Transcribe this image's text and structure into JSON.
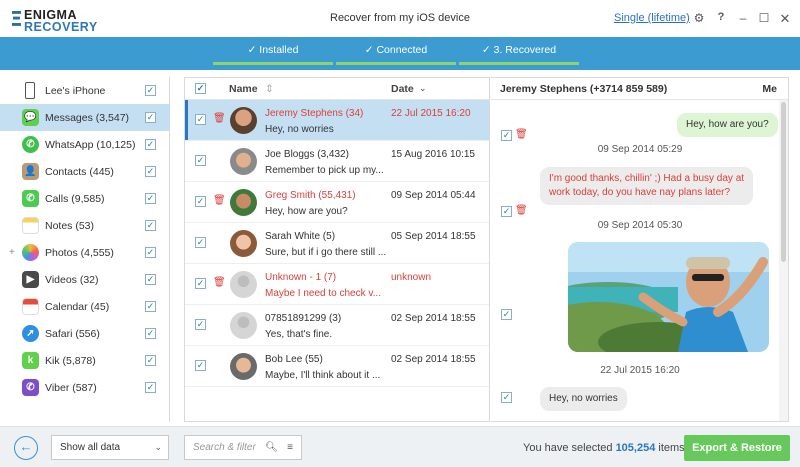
{
  "app": {
    "logo_line1": "ENIGMA",
    "logo_line2": "RECOVERY",
    "window_title": "Recover from my iOS device",
    "license_link": "Single (lifetime)",
    "icons": [
      "gear-icon",
      "help-icon",
      "minimize-icon",
      "maximize-icon",
      "close-icon"
    ]
  },
  "steps": [
    {
      "label": "Installed"
    },
    {
      "label": "Connected"
    },
    {
      "label": "3. Recovered"
    }
  ],
  "sidebar": {
    "items": [
      {
        "label": "Lee's iPhone",
        "icon": "iphone-icon",
        "checked": true
      },
      {
        "label": "Messages (3,547)",
        "icon": "messages-icon",
        "checked": true,
        "active": true
      },
      {
        "label": "WhatsApp (10,125)",
        "icon": "whatsapp-icon",
        "checked": true
      },
      {
        "label": "Contacts (445)",
        "icon": "contacts-icon",
        "checked": true
      },
      {
        "label": "Calls (9,585)",
        "icon": "calls-icon",
        "checked": true
      },
      {
        "label": "Notes (53)",
        "icon": "notes-icon",
        "checked": true
      },
      {
        "label": "Photos (4,555)",
        "icon": "photos-icon",
        "checked": true,
        "expandable": true
      },
      {
        "label": "Videos (32)",
        "icon": "videos-icon",
        "checked": true
      },
      {
        "label": "Calendar (45)",
        "icon": "calendar-icon",
        "checked": true
      },
      {
        "label": "Safari (556)",
        "icon": "safari-icon",
        "checked": true
      },
      {
        "label": "Kik (5,878)",
        "icon": "kik-icon",
        "checked": true
      },
      {
        "label": "Viber (587)",
        "icon": "viber-icon",
        "checked": true
      }
    ]
  },
  "list": {
    "headers": {
      "name": "Name",
      "date": "Date"
    },
    "rows": [
      {
        "name": "Jeremy Stephens (34)",
        "message": "Hey, no worries",
        "date": "22 Jul 2015 16:20",
        "deleted": true,
        "selected": true
      },
      {
        "name": "Joe Bloggs (3,432)",
        "message": "Remember to pick up my...",
        "date": "15 Aug 2016 10:15",
        "deleted": false
      },
      {
        "name": "Greg Smith (55,431)",
        "message": "Hey, how are you?",
        "date": "09 Sep 2014 05:44",
        "deleted": true
      },
      {
        "name": "Sarah White (5)",
        "message": "Sure, but if i go there still ...",
        "date": "05 Sep 2014 18:55",
        "deleted": false
      },
      {
        "name": "Unknown - 1 (7)",
        "message": "Maybe I need to check v...",
        "date": "unknown",
        "deleted": true
      },
      {
        "name": "07851891299 (3)",
        "message": "Yes, that's fine.",
        "date": "02 Sep 2014 18:55",
        "deleted": false
      },
      {
        "name": "Bob Lee (55)",
        "message": "Maybe, I'll think about it ...",
        "date": "02 Sep 2014 18:55",
        "deleted": false
      }
    ]
  },
  "conversation": {
    "contact": "Jeremy Stephens (+3714 859 589)",
    "me_label": "Me",
    "messages": [
      {
        "text": "Hey, how are you?",
        "from": "me"
      },
      {
        "date": "09 Sep 2014 05:29"
      },
      {
        "text_line1": "I'm good thanks, chillin' ;) Had a busy day at",
        "text_line2": "work today, do you have nay plans later?",
        "from": "them",
        "deleted": true
      },
      {
        "date": "09 Sep 2014 05:30"
      },
      {
        "photo": true,
        "from": "them"
      },
      {
        "date": "22 Jul 2015 16:20"
      },
      {
        "text": "Hey, no worries",
        "from": "them"
      }
    ]
  },
  "footer": {
    "filter_select": "Show all data",
    "search_placeholder": "Search & filter",
    "selected_prefix": "You have selected",
    "selected_count": "105,254",
    "selected_suffix": "items",
    "export_button": "Export & Restore"
  },
  "colors": {
    "accent": "#3c9bd1",
    "deleted": "#d9403a",
    "export": "#67c95b",
    "selection": "#c5dff2"
  }
}
